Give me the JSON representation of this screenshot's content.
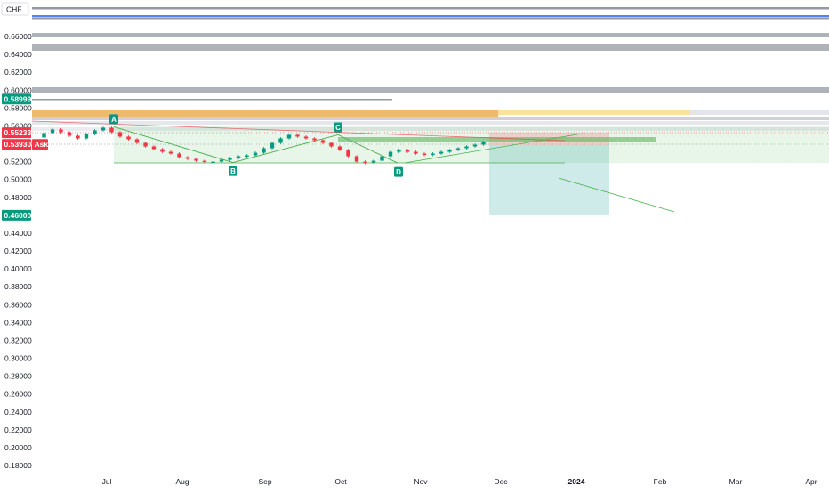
{
  "currency_label": "CHF",
  "price_badges": [
    {
      "label": "0.58999",
      "value": 0.58999,
      "color": "#089981"
    },
    {
      "label": "0.55233",
      "value": 0.55233,
      "color": "#f23645"
    },
    {
      "label": "0.53930",
      "value": 0.5393,
      "color": "#f23645"
    },
    {
      "label": "0.46000",
      "value": 0.46,
      "color": "#089981"
    }
  ],
  "ask_label": "Ask",
  "pattern_points": [
    "A",
    "B",
    "C",
    "D"
  ],
  "colors": {
    "up": "#089981",
    "down": "#f23645",
    "zone_green": "#4caf50",
    "zone_gray": "#787b86",
    "zone_orange": "#e8a33a",
    "zone_yellow": "#f5d76e",
    "zone_blue": "#2962ff",
    "target_box": "#26a69a"
  },
  "chart_data": {
    "type": "candlestick",
    "y_axis": {
      "range": [
        0.17,
        0.7
      ],
      "ticks": [
        "0.66000",
        "0.64000",
        "0.62000",
        "0.60000",
        "0.58000",
        "0.56000",
        "0.54000",
        "0.52000",
        "0.50000",
        "0.48000",
        "0.44000",
        "0.42000",
        "0.40000",
        "0.38000",
        "0.36000",
        "0.34000",
        "0.32000",
        "0.30000",
        "0.28000",
        "0.26000",
        "0.24000",
        "0.22000",
        "0.20000",
        "0.18000"
      ]
    },
    "x_axis": {
      "ticks": [
        {
          "label": "Jul",
          "bold": false
        },
        {
          "label": "Aug",
          "bold": false
        },
        {
          "label": "Sep",
          "bold": false
        },
        {
          "label": "Oct",
          "bold": false
        },
        {
          "label": "Nov",
          "bold": false
        },
        {
          "label": "Dec",
          "bold": false
        },
        {
          "label": "2024",
          "bold": true
        },
        {
          "label": "Feb",
          "bold": false
        },
        {
          "label": "Mar",
          "bold": false
        },
        {
          "label": "Apr",
          "bold": false
        }
      ]
    },
    "pattern": [
      {
        "label": "A",
        "price": 0.559
      },
      {
        "label": "B",
        "price": 0.519
      },
      {
        "label": "C",
        "price": 0.55
      },
      {
        "label": "D",
        "price": 0.518
      }
    ],
    "path_prices": [
      0.547,
      0.552,
      0.556,
      0.553,
      0.549,
      0.546,
      0.551,
      0.555,
      0.558,
      0.553,
      0.548,
      0.545,
      0.541,
      0.537,
      0.534,
      0.531,
      0.529,
      0.525,
      0.523,
      0.521,
      0.52,
      0.52,
      0.522,
      0.524,
      0.526,
      0.527,
      0.53,
      0.535,
      0.541,
      0.546,
      0.55,
      0.548,
      0.546,
      0.544,
      0.541,
      0.537,
      0.533,
      0.526,
      0.52,
      0.519,
      0.521,
      0.526,
      0.531,
      0.533,
      0.531,
      0.529,
      0.528,
      0.529,
      0.531,
      0.533,
      0.535,
      0.537,
      0.539,
      0.542
    ]
  }
}
